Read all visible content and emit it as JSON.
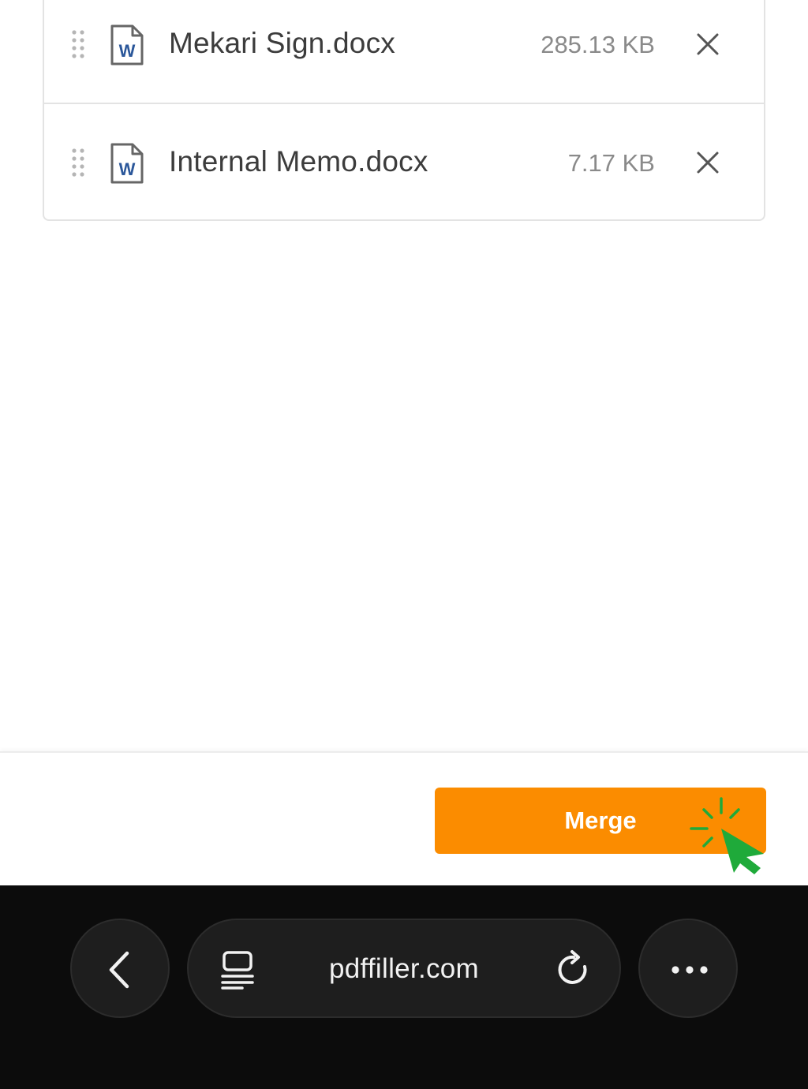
{
  "files": [
    {
      "name": "Mekari Sign.docx",
      "size": "285.13 KB",
      "icon": "word-doc-icon"
    },
    {
      "name": "Internal Memo.docx",
      "size": "7.17 KB",
      "icon": "word-doc-icon"
    }
  ],
  "footer": {
    "merge_label": "Merge"
  },
  "browser": {
    "url": "pdffiller.com"
  },
  "colors": {
    "accent": "#fb8c00",
    "cursor": "#1faa3a",
    "word_blue": "#2b579a"
  }
}
